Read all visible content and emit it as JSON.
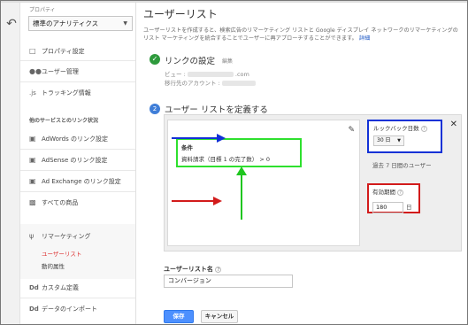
{
  "nav": {
    "back_icon": "arrow-left-icon",
    "property_section": "プロパティ",
    "property_select": "標準のアナリティクス",
    "items": [
      {
        "label": "プロパティ設定",
        "icon": "page-icon"
      },
      {
        "label": "ユーザー管理",
        "icon": "people-icon"
      },
      {
        "label": "トラッキング情報",
        "icon": "js-icon"
      }
    ],
    "link_section": "他のサービスとのリンク状況",
    "link_items": [
      {
        "label": "AdWords のリンク設定",
        "icon": "adwords-icon"
      },
      {
        "label": "AdSense のリンク設定",
        "icon": "adsense-icon"
      },
      {
        "label": "Ad Exchange のリンク設定",
        "icon": "adexchange-icon"
      },
      {
        "label": "すべての商品",
        "icon": "all-products-icon"
      }
    ],
    "remarketing": {
      "label": "リマーケティング",
      "icon": "funnel-icon",
      "sub": [
        {
          "label": "ユーザーリスト",
          "active": true
        },
        {
          "label": "動的属性",
          "active": false
        }
      ]
    },
    "bottom_items": [
      {
        "label": "カスタム定義",
        "icon": "dd-icon"
      },
      {
        "label": "データのインポート",
        "icon": "dd-icon"
      }
    ]
  },
  "main": {
    "title": "ユーザーリスト",
    "description": "ユーザーリストを作成すると、検索広告のリマーケティング リストと Google ディスプレイ ネットワークのリマーケティングのリスト マーケティングを統合することでユーザーに再アプローチすることができます。",
    "description_link": "詳細",
    "step1": {
      "title": "リンクの設定",
      "edit": "編集",
      "view_label": "ビュー :",
      "view_value": ".com",
      "account_label": "移行先のアカウント :"
    },
    "step2": {
      "number": "2",
      "title": "ユーザー リストを定義する"
    },
    "condition": {
      "heading": "条件",
      "value": "資料請求（目標 1 の完了数） > 0"
    },
    "lookback": {
      "label": "ルックバック日数",
      "value": "30 日"
    },
    "past_users": "過去 7 日間のユーザー",
    "duration": {
      "label": "有効期間",
      "value": "180",
      "unit": "日"
    },
    "list_name": {
      "label": "ユーザーリスト名",
      "value": "コンバージョン"
    },
    "save_label": "保存",
    "cancel_label": "キャンセル"
  },
  "colors": {
    "green_highlight": "#2ee02e",
    "blue_highlight": "#1131d6",
    "red_highlight": "#d21b1b",
    "save_button": "#4d90fe"
  }
}
